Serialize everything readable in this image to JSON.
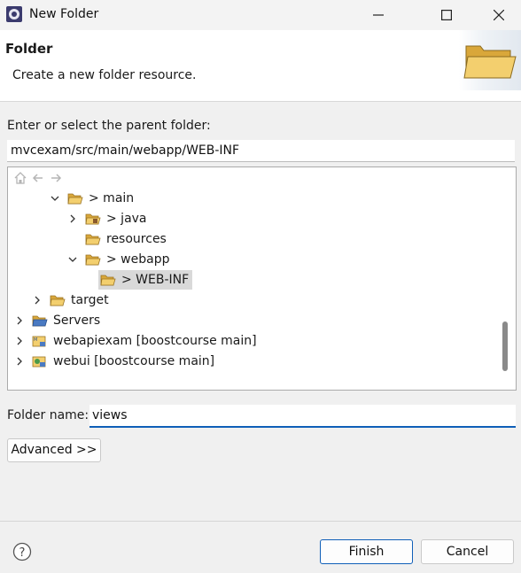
{
  "window": {
    "title": "New Folder",
    "icon": "eclipse-icon"
  },
  "header": {
    "title": "Folder",
    "description": "Create a new folder resource.",
    "icon": "folder-large-icon"
  },
  "parent": {
    "label": "Enter or select the parent folder:",
    "value": "mvcexam/src/main/webapp/WEB-INF"
  },
  "tree": {
    "toolbar": [
      "home-icon",
      "back-arrow-icon",
      "forward-arrow-icon"
    ],
    "items": [
      {
        "label": "> main",
        "expanded": true,
        "icon": "folder-icon"
      },
      {
        "label": "> java",
        "expanded": false,
        "icon": "package-folder-icon"
      },
      {
        "label": "resources",
        "expanded": null,
        "icon": "folder-icon"
      },
      {
        "label": "> webapp",
        "expanded": true,
        "icon": "folder-icon"
      },
      {
        "label": "> WEB-INF",
        "expanded": null,
        "icon": "folder-icon",
        "selected": true
      },
      {
        "label": "target",
        "expanded": false,
        "icon": "folder-icon"
      },
      {
        "label": "Servers",
        "expanded": false,
        "icon": "servers-folder-icon"
      },
      {
        "label": "webapiexam [boostcourse main]",
        "expanded": false,
        "icon": "maven-project-icon"
      },
      {
        "label": "webui [boostcourse main]",
        "expanded": false,
        "icon": "web-project-icon"
      }
    ]
  },
  "folder_name": {
    "label": "Folder name:",
    "value": "views"
  },
  "buttons": {
    "advanced": "Advanced >>",
    "finish": "Finish",
    "cancel": "Cancel"
  },
  "colors": {
    "accent": "#0f5fb8",
    "folder": "#e8b84a",
    "selection": "#d9d9d9"
  }
}
